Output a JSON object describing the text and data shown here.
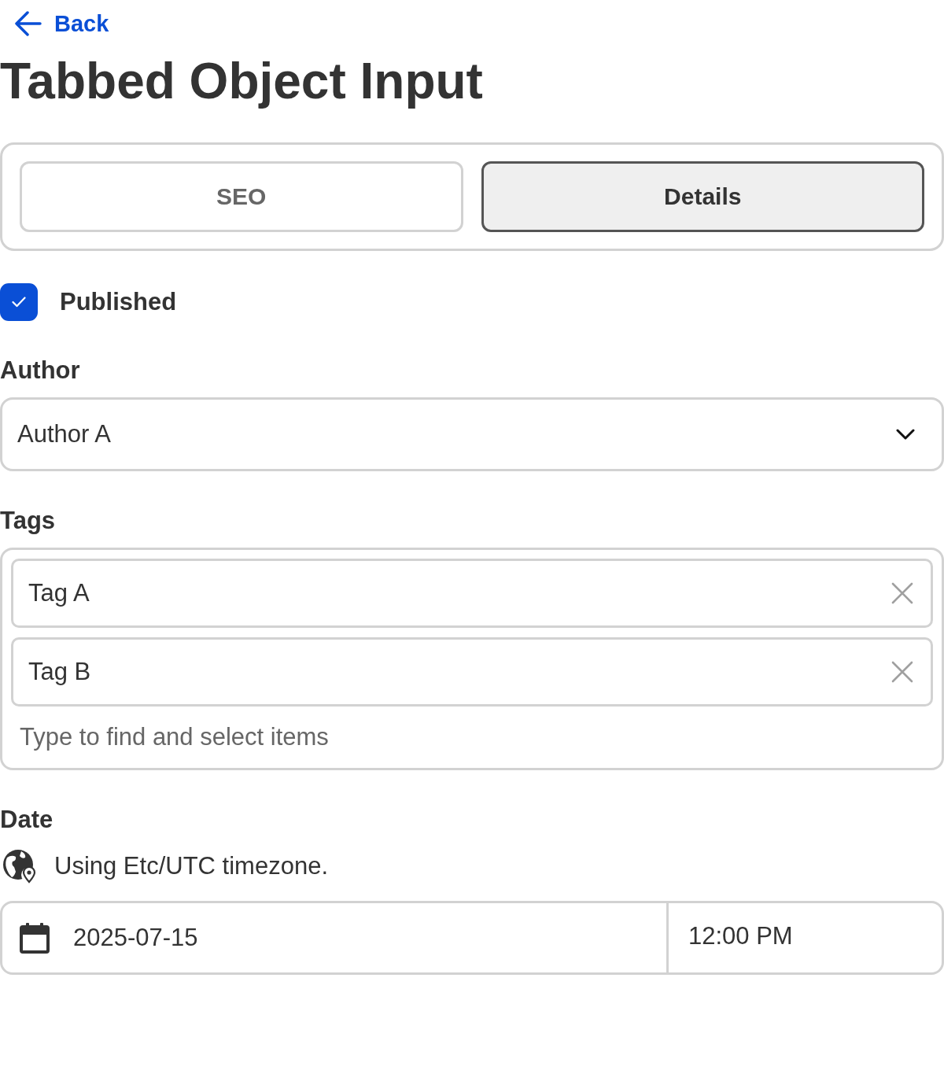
{
  "back_link": {
    "label": "Back"
  },
  "title": "Tabbed Object Input",
  "tabs": [
    {
      "label": "SEO",
      "selected": false
    },
    {
      "label": "Details",
      "selected": true
    }
  ],
  "fields": [
    {
      "kind": "checkbox",
      "label": "Published",
      "checked": true
    },
    {
      "kind": "select",
      "label": "Author",
      "value": "Author A"
    },
    {
      "kind": "tags",
      "label": "Tags",
      "items": [
        {
          "label": "Tag A"
        },
        {
          "label": "Tag B"
        }
      ],
      "placeholder": "Type to find and select items"
    },
    {
      "kind": "datetime",
      "label": "Date",
      "timezone_note": "Using Etc/UTC timezone.",
      "date": "2025-07-15",
      "time": "12:00 PM"
    }
  ]
}
